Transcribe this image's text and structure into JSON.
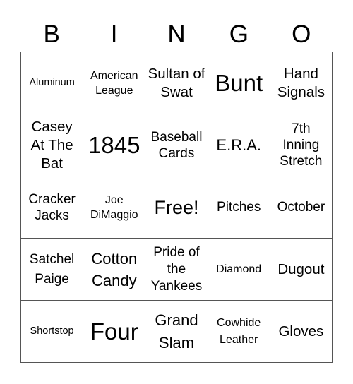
{
  "header": {
    "letters": [
      "B",
      "I",
      "N",
      "G",
      "O"
    ]
  },
  "card": {
    "rows": [
      [
        "Aluminum",
        "American League",
        "Sultan of Swat",
        "Bunt",
        "Hand Signals"
      ],
      [
        "Casey At The Bat",
        "1845",
        "Baseball Cards",
        "E.R.A.",
        "7th Inning Stretch"
      ],
      [
        "Cracker Jacks",
        "Joe DiMaggio",
        "Free!",
        "Pitches",
        "October"
      ],
      [
        "Satchel Paige",
        "Cotton Candy",
        "Pride of the Yankees",
        "Diamond",
        "Dugout"
      ],
      [
        "Shortstop",
        "Four",
        "Grand Slam",
        "Cowhide Leather",
        "Gloves"
      ]
    ]
  }
}
